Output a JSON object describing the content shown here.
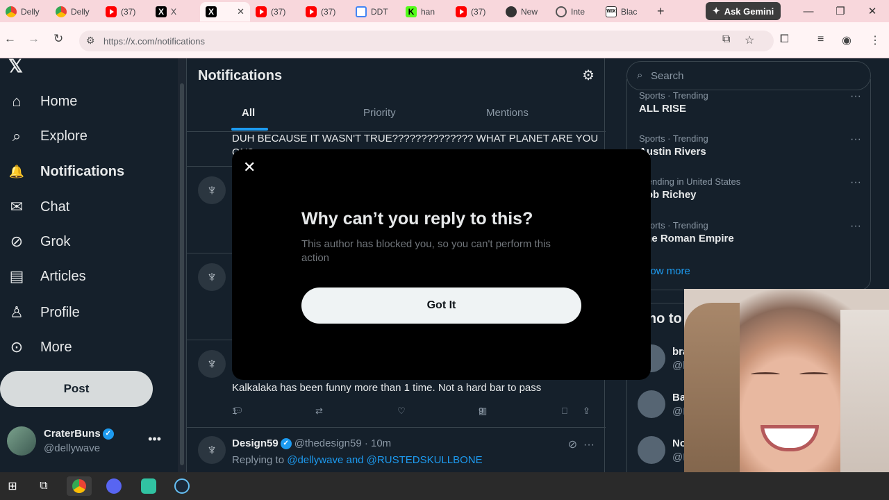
{
  "browser": {
    "tabs": [
      {
        "label": "Delly",
        "icon": "chrome-icon"
      },
      {
        "label": "Delly",
        "icon": "chrome-icon"
      },
      {
        "label": "(37)",
        "icon": "youtube-icon"
      },
      {
        "label": "X",
        "icon": "x-icon"
      },
      {
        "label": "",
        "icon": "x-icon",
        "active": true
      },
      {
        "label": "(37)",
        "icon": "youtube-icon"
      },
      {
        "label": "(37)",
        "icon": "youtube-icon"
      },
      {
        "label": "DDT",
        "icon": "calendar-icon"
      },
      {
        "label": "han",
        "icon": "kick-icon"
      },
      {
        "label": "(37)",
        "icon": "youtube-icon"
      },
      {
        "label": "New",
        "icon": "github-icon"
      },
      {
        "label": "Inte",
        "icon": "globe-icon"
      },
      {
        "label": "Blac",
        "icon": "wix-icon"
      }
    ],
    "new_tab": "+",
    "gemini_label": "Ask Gemini",
    "url": "https://x.com/notifications"
  },
  "nav": {
    "logo": "𝕏",
    "items": [
      {
        "label": "Home",
        "icon": "home-icon",
        "glyph": "⌂"
      },
      {
        "label": "Explore",
        "icon": "search-icon",
        "glyph": "⌕"
      },
      {
        "label": "Notifications",
        "icon": "bell-icon",
        "glyph": "🔔",
        "active": true
      },
      {
        "label": "Chat",
        "icon": "mail-icon",
        "glyph": "✉"
      },
      {
        "label": "Grok",
        "icon": "grok-icon",
        "glyph": "⊘"
      },
      {
        "label": "Articles",
        "icon": "article-icon",
        "glyph": "▤"
      },
      {
        "label": "Profile",
        "icon": "person-icon",
        "glyph": "♙"
      },
      {
        "label": "More",
        "icon": "more-icon",
        "glyph": "⊙"
      }
    ],
    "post_label": "Post",
    "account": {
      "name": "CraterBuns",
      "handle": "@dellywave"
    }
  },
  "main": {
    "title": "Notifications",
    "tabs": [
      "All",
      "Priority",
      "Mentions"
    ],
    "partial_text": "DUH BECAUSE IT WASN'T TRUE??????????????  WHAT PLANET ARE YOU ON?",
    "reply_text": "Kalkalaka has been funny more than 1 time. Not a hard bar to pass",
    "actions": {
      "replies": "1",
      "views": "9"
    },
    "thread": {
      "name": "Design59",
      "handle": "@thedesign59 · 10m",
      "replying_prefix": "Replying to ",
      "replying_to": "@dellywave and @RUSTEDSKULLBONE"
    }
  },
  "sidebar": {
    "search_placeholder": "Search",
    "trends": [
      {
        "category": "Sports · Trending",
        "name": "ALL RISE"
      },
      {
        "category": "Sports · Trending",
        "name": "Austin Rivers"
      },
      {
        "category": "Trending in United States",
        "name": "Bob Richey"
      },
      {
        "category": "Sports · Trending",
        "name": "The Roman Empire"
      }
    ],
    "show_more": "Show more",
    "who_to_follow": "Who to follow",
    "follow": [
      {
        "name": "brainrot",
        "handle": "@brain"
      },
      {
        "name": "Basil",
        "handle": "@Ba"
      },
      {
        "name": "Nob",
        "handle": "@Ne"
      }
    ]
  },
  "modal": {
    "close": "✕",
    "title": "Why can’t you reply to this?",
    "description": "This author has blocked you, so you can't perform this action",
    "button": "Got It"
  },
  "colors": {
    "accent": "#1d9bf0",
    "background": "#15202b",
    "modal": "#000000"
  }
}
